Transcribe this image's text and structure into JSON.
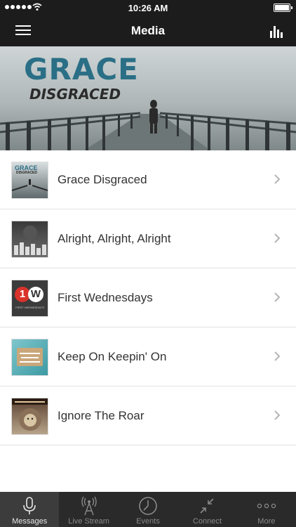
{
  "status_bar": {
    "time": "10:26 AM"
  },
  "header": {
    "title": "Media"
  },
  "hero": {
    "title": "GRACE",
    "subtitle": "DISGRACED"
  },
  "thumbnails": {
    "grace_disgraced": {
      "title": "GRACE",
      "subtitle": "DISGRACED"
    },
    "first_wednesdays": {
      "badge_number": "1",
      "badge_letter": "W",
      "caption": "FIRST WEDNESDAYS"
    }
  },
  "media_items": [
    {
      "label": "Grace Disgraced"
    },
    {
      "label": "Alright, Alright, Alright"
    },
    {
      "label": "First Wednesdays"
    },
    {
      "label": "Keep On Keepin' On"
    },
    {
      "label": "Ignore The Roar"
    }
  ],
  "tabs": [
    {
      "label": "Messages",
      "icon": "microphone-icon",
      "active": true
    },
    {
      "label": "Live Stream",
      "icon": "broadcast-tower-icon",
      "active": false
    },
    {
      "label": "Events",
      "icon": "clock-icon",
      "active": false
    },
    {
      "label": "Connect",
      "icon": "connect-arrows-icon",
      "active": false
    },
    {
      "label": "More",
      "icon": "more-dots-icon",
      "active": false
    }
  ],
  "colors": {
    "bar_background": "#1c1c1c",
    "tab_background": "#2a2a2a",
    "hero_title": "#2a6f86"
  }
}
